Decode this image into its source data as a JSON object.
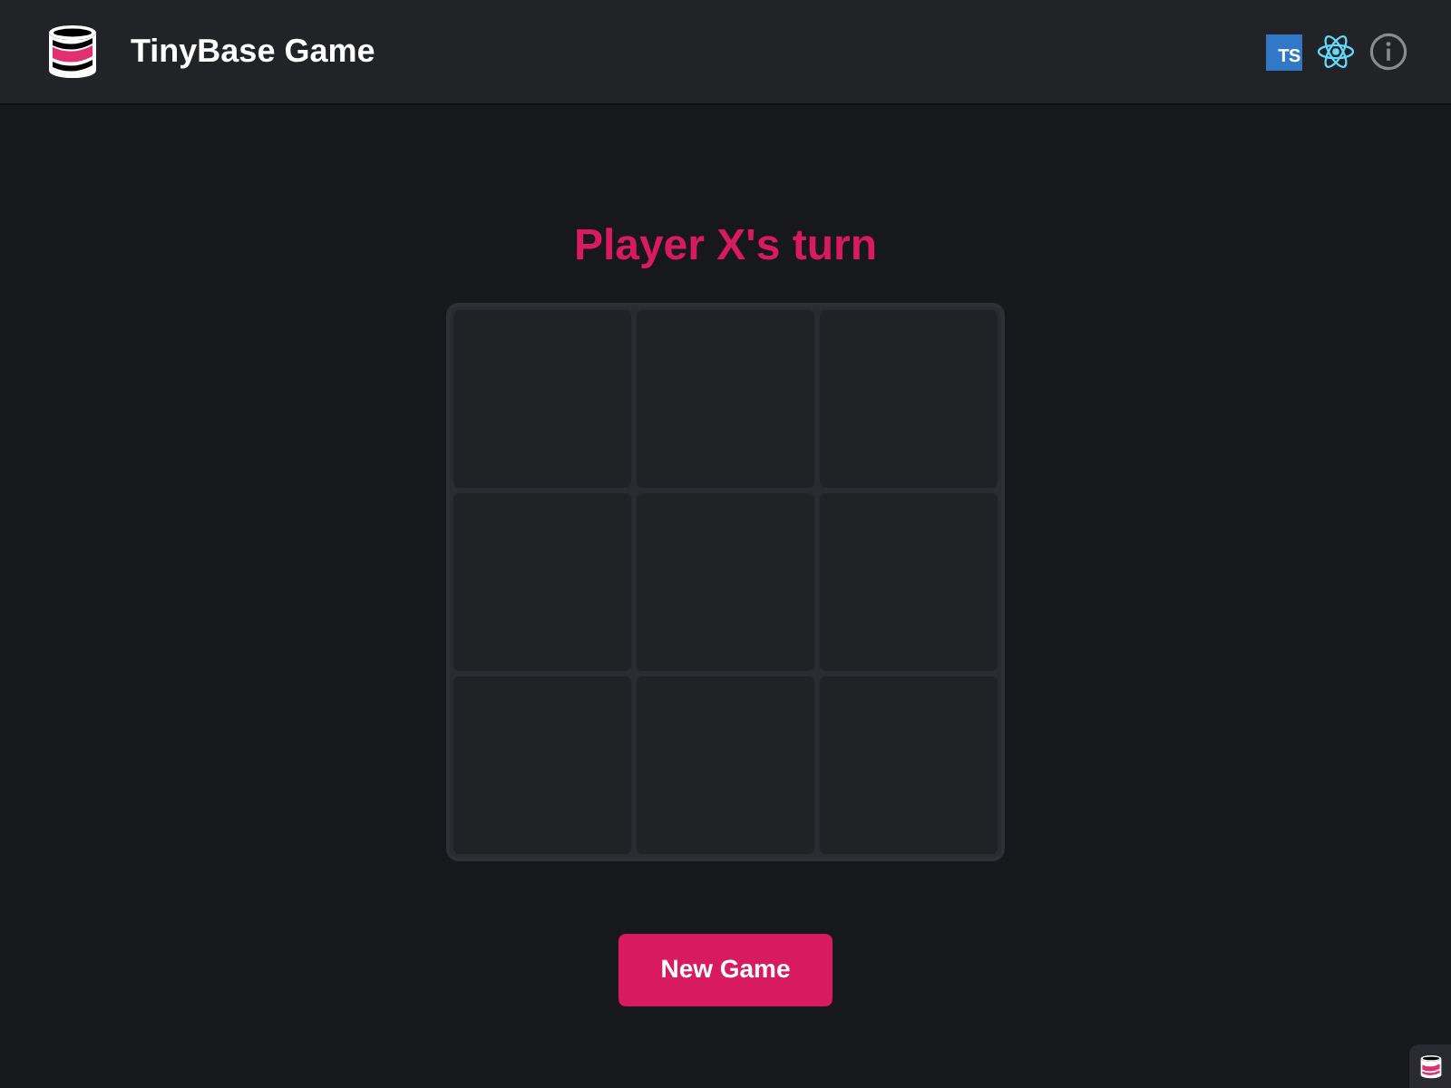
{
  "header": {
    "title": "TinyBase Game",
    "ts_logo": "TS"
  },
  "game": {
    "status": "Player X's turn",
    "cells": [
      {
        "kind": "empty"
      },
      {
        "kind": "empty"
      },
      {
        "kind": "empty"
      },
      {
        "kind": "empty"
      },
      {
        "kind": "empty"
      },
      {
        "kind": "empty"
      },
      {
        "kind": "empty"
      },
      {
        "kind": "empty"
      },
      {
        "kind": "empty"
      }
    ],
    "button": "New Game"
  }
}
